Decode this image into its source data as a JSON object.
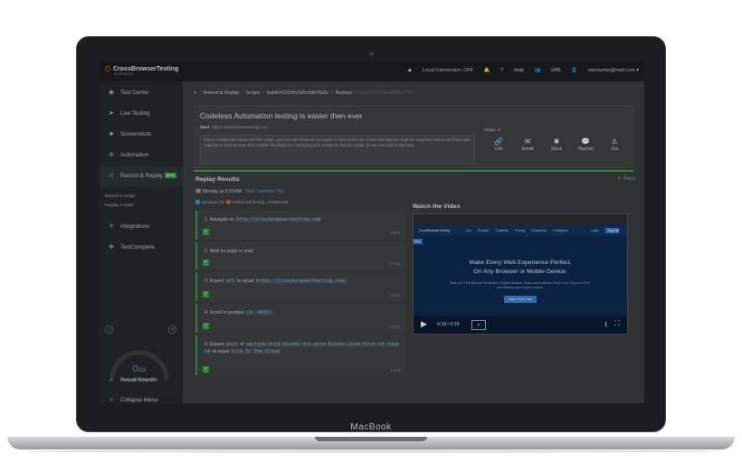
{
  "device": {
    "brand_label": "MacBook"
  },
  "app": {
    "logo_name": "CrossBrowserTesting",
    "logo_sub": "SMARTBEAR",
    "topbar": {
      "local_connection": "Local Connection: OFF",
      "help": "Help",
      "user_count": "9/86",
      "user_email": "username@mail.com"
    },
    "sidebar": {
      "items": [
        {
          "label": "Test Center",
          "icon": "dashboard-icon"
        },
        {
          "label": "Live Testing",
          "icon": "cursor-icon"
        },
        {
          "label": "Screenshots",
          "icon": "camera-icon"
        },
        {
          "label": "Automation",
          "icon": "gears-icon"
        },
        {
          "label": "Record & Replay",
          "icon": "record-icon",
          "badge": "BETA"
        },
        {
          "label": "Integrations",
          "icon": "puzzle-icon"
        },
        {
          "label": "TestComplete",
          "icon": "testcomplete-icon"
        }
      ],
      "subitems": [
        "Record a Script",
        "Replay a Suite"
      ],
      "parallels": {
        "used": "0",
        "total": "/15",
        "label": "Automated Parallels"
      },
      "result_search": "Result Search",
      "collapse": "Collapse Menu"
    },
    "breadcrumb": {
      "items": [
        "Record & Replay",
        "Scripts",
        "5ab41422195c026c93676d2c",
        "Replays"
      ],
      "current": "5ac23c0f206a66fb8e718e"
    },
    "script": {
      "title": "Codeless Automation testing is easier then ever",
      "start_label": "Start",
      "start_url": "http://crossbrowsertesting.com",
      "description": "this is a longer description for this script - you can add whatever you want in here to fill it up. Some descriptions might be long then others and there also might be a need for note that include #hashtags for managing your scripts as that list grows. So we can look at that later.",
      "share_label": "Share",
      "share_options": [
        {
          "label": "Link",
          "icon": "link-icon"
        },
        {
          "label": "Email",
          "icon": "email-icon"
        },
        {
          "label": "Slack",
          "icon": "slack-icon"
        },
        {
          "label": "Hipchat",
          "icon": "hipchat-icon"
        },
        {
          "label": "Jira",
          "icon": "jira-icon"
        }
      ]
    },
    "results": {
      "title": "Replay Results",
      "status": "Pass",
      "date": "Monday at 9:19 AM",
      "selenium_link": "View Selenium Test",
      "os": "Windows 10",
      "browser": "Firefox 58 (64-bit)",
      "resolution": "1366x768",
      "steps": [
        {
          "num": "1",
          "pre": "Navigate to",
          "code": "http://crossbrowsertesting.com",
          "post": "",
          "duration": "3.87s"
        },
        {
          "num": "2",
          "pre": "Wait for page to load",
          "code": "",
          "post": "",
          "duration": "2.39s"
        },
        {
          "num": "3",
          "pre": "Expect",
          "code": "url",
          "mid": "to equal",
          "code2": "https://crossbrowsertesting.com/",
          "duration": "0.22s"
        },
        {
          "num": "4",
          "pre": "Scroll to position",
          "code": "[0, 4631]",
          "post": "",
          "duration": "0.22s"
        },
        {
          "num": "5",
          "pre": "Expect",
          "code": "text",
          "mid": "of",
          "code2": "section.grid-blocks div.grid-blocks-item:first-of-type h4",
          "mid2": "to equal",
          "code3": "Grid In The Cloud",
          "duration": "1.91s"
        }
      ]
    },
    "video": {
      "title": "Watch the Video",
      "site_logo": "CrossBrowserTesting",
      "nav_items": [
        "Tour",
        "Product",
        "Solutions",
        "Pricing",
        "Resources",
        "Enterprise",
        "Login",
        "Sign Up Free"
      ],
      "hero_line1": "Make Every Web Experience Perfect,",
      "hero_line2": "On Any Browser or Mobile Device.",
      "hero_sub": "Start your Free trial and Screenshot, Explore Manual, Visual, and Selenium Tests in the Cloud on 1500+ real desktop and mobile browsers.",
      "cta": "Start a Free Trial",
      "time": "0:18 / 0:26",
      "progress": 0.69
    }
  }
}
